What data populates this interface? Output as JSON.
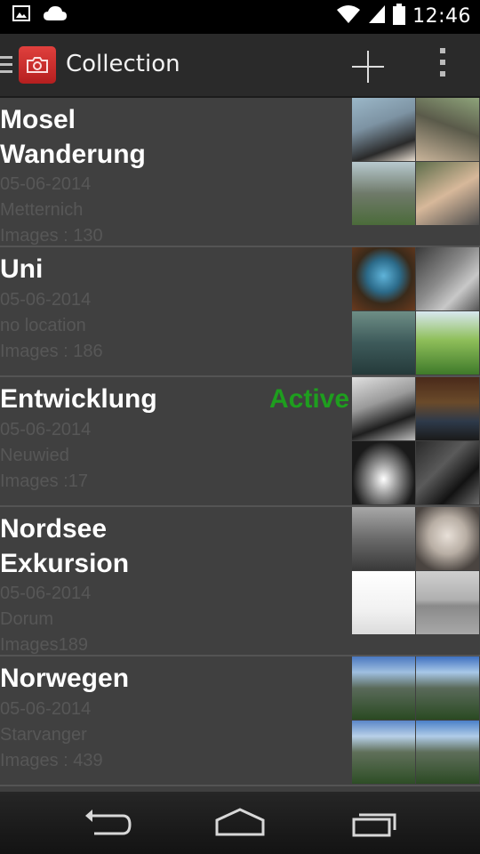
{
  "status_bar": {
    "time": "12:46",
    "icons": [
      "image-notification-icon",
      "cloud-icon",
      "wifi-icon",
      "cell-signal-icon",
      "battery-icon"
    ]
  },
  "action_bar": {
    "title": "Collection",
    "icons": [
      "drawer-menu-icon",
      "camera-app-icon",
      "add-icon",
      "overflow-menu-icon"
    ]
  },
  "collections": [
    {
      "title": "Mosel\nWanderung",
      "date": "05-06-2014",
      "location": "Metternich",
      "images_label": "Images :   130",
      "active": ""
    },
    {
      "title": "Uni",
      "date": "05-06-2014",
      "location": "no location",
      "images_label": "Images :    186",
      "active": ""
    },
    {
      "title": "Entwicklung",
      "date": "05-06-2014",
      "location": "Neuwied",
      "images_label": "Images :17",
      "active": "Active"
    },
    {
      "title": "Nordsee\nExkursion",
      "date": "05-06-2014",
      "location": "Dorum",
      "images_label": "Images189",
      "active": ""
    },
    {
      "title": "Norwegen",
      "date": "05-06-2014",
      "location": "Starvanger",
      "images_label": "Images :    439",
      "active": ""
    }
  ],
  "nav_bar": {
    "icons": [
      "back-icon",
      "home-icon",
      "recents-icon"
    ]
  },
  "colors": {
    "active": "#1e9e1e",
    "background": "#3f3f3f",
    "app_icon": "#d0302e"
  }
}
